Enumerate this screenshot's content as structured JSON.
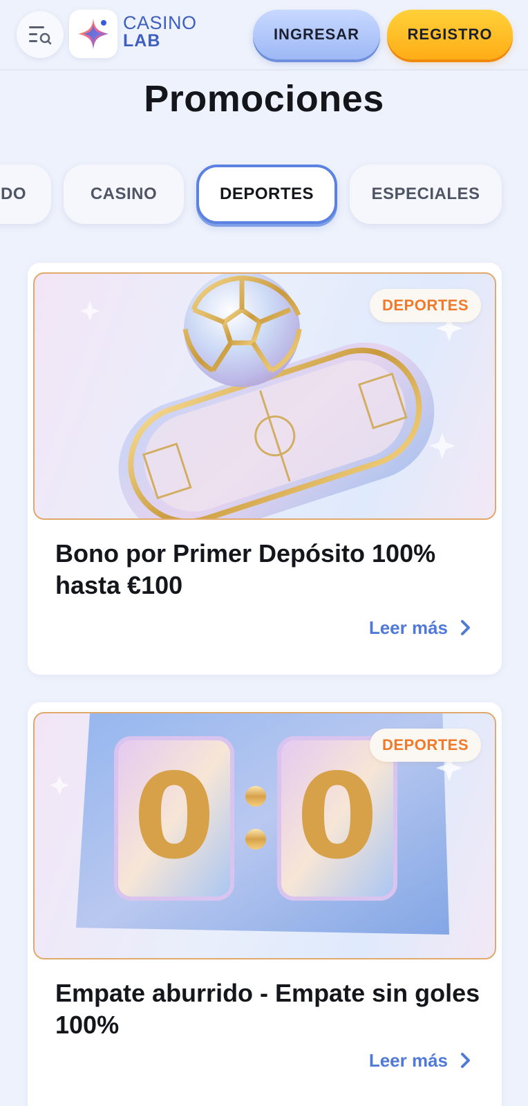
{
  "header": {
    "menu_icon": "menu-search-icon",
    "logo": {
      "line1": "CASINO",
      "line2": "LAB",
      "icon": "sparkle-star-logo"
    },
    "login_label": "INGRESAR",
    "register_label": "REGISTRO",
    "colors": {
      "login": "#a9c0f8",
      "register": "#ffb51f",
      "logo_text": "#3f5fbf"
    }
  },
  "page": {
    "title": "Promociones"
  },
  "tabs": [
    {
      "label": "DO",
      "active": false
    },
    {
      "label": "CASINO",
      "active": false
    },
    {
      "label": "DEPORTES",
      "active": true
    },
    {
      "label": "ESPECIALES",
      "active": false
    }
  ],
  "promos": [
    {
      "badge": "DEPORTES",
      "title": "Bono por Primer Depósito 100% hasta €100",
      "read_more": "Leer más",
      "image": "football-on-stadium-illustration"
    },
    {
      "badge": "DEPORTES",
      "title": "Empate aburrido - Empate sin goles 100%",
      "read_more": "Leer más",
      "image": "scoreboard-0-0-illustration",
      "score": {
        "home": "0",
        "away": "0"
      }
    }
  ],
  "colors": {
    "page_bg": "#eef2fc",
    "accent": "#5079d8",
    "badge_text": "#f07a2a",
    "card_border": "#e0a86a"
  }
}
